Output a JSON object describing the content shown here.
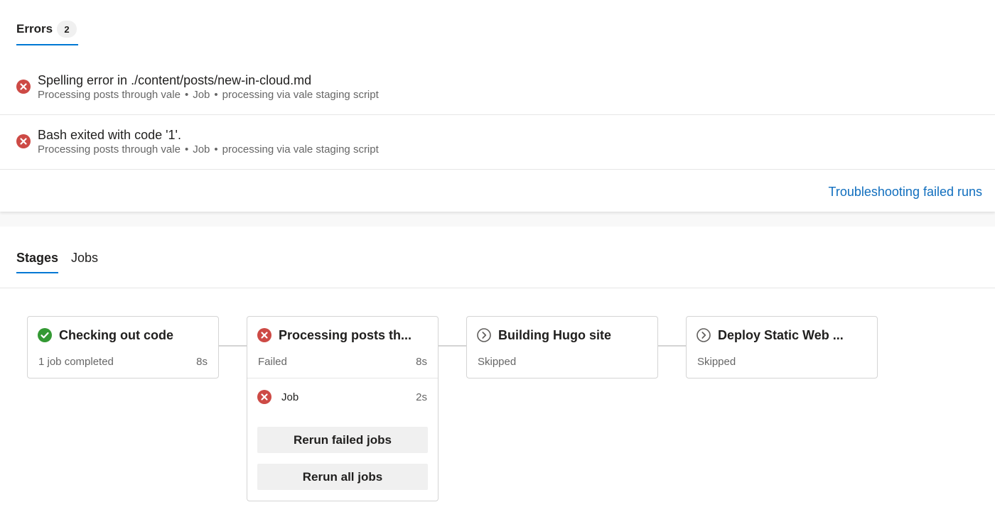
{
  "errors": {
    "tab_label": "Errors",
    "count": "2",
    "items": [
      {
        "title": "Spelling error in ./content/posts/new-in-cloud.md",
        "meta": [
          "Processing posts through vale",
          "Job",
          "processing via vale staging script"
        ]
      },
      {
        "title": "Bash exited with code '1'.",
        "meta": [
          "Processing posts through vale",
          "Job",
          "processing via vale staging script"
        ]
      }
    ],
    "separator": "•",
    "troubleshoot_link": "Troubleshooting failed runs"
  },
  "tabs": [
    {
      "label": "Stages",
      "active": true
    },
    {
      "label": "Jobs",
      "active": false
    }
  ],
  "stages": [
    {
      "name": "Checking out code",
      "status": "1 job completed",
      "duration": "8s",
      "icon": "check-circle-icon"
    },
    {
      "name": "Processing posts th...",
      "status": "Failed",
      "duration": "8s",
      "icon": "error-circle-icon",
      "job": {
        "name": "Job",
        "duration": "2s",
        "icon": "error-circle-icon"
      },
      "buttons": {
        "rerun_failed": "Rerun failed jobs",
        "rerun_all": "Rerun all jobs"
      }
    },
    {
      "name": "Building Hugo site",
      "status": "Skipped",
      "icon": "skipped-circle-icon"
    },
    {
      "name": "Deploy Static Web ...",
      "status": "Skipped",
      "icon": "skipped-circle-icon"
    }
  ],
  "colors": {
    "accent": "#0078d4",
    "error": "#cd4a45",
    "success": "#339933",
    "link": "#106ebe",
    "skipped": "#605e5c"
  }
}
